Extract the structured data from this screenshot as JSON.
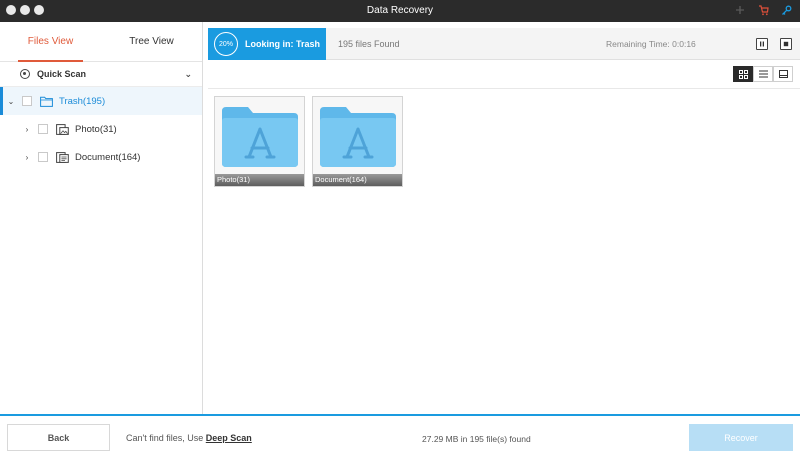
{
  "window": {
    "title": "Data Recovery",
    "icons": [
      "plus-icon",
      "cart-icon",
      "key-icon"
    ]
  },
  "sidebar": {
    "tabs": [
      {
        "label": "Files View",
        "active": true
      },
      {
        "label": "Tree View",
        "active": false
      }
    ],
    "quick_scan": "Quick Scan",
    "tree": [
      {
        "label": "Trash(195)",
        "selected": true,
        "icon": "folder-icon"
      },
      {
        "label": "Photo(31)",
        "selected": false,
        "icon": "photo-file-icon"
      },
      {
        "label": "Document(164)",
        "selected": false,
        "icon": "document-file-icon"
      }
    ]
  },
  "scan": {
    "progress": "20%",
    "looking_in": "Looking in: Trash",
    "files_found": "195 files Found",
    "remaining_time": "Remaining Time: 0:0:16"
  },
  "content": {
    "items": [
      {
        "label": "Photo(31)"
      },
      {
        "label": "Document(164)"
      }
    ]
  },
  "footer": {
    "back_label": "Back",
    "cant_find_prefix": "Can't find files, Use ",
    "deep_scan_label": "Deep Scan",
    "summary": "27.29 MB in 195 file(s) found",
    "recover_label": "Recover"
  },
  "colors": {
    "accent": "#1a9be0",
    "tab_active": "#e05a3a",
    "folder": "#6cc4f0"
  }
}
